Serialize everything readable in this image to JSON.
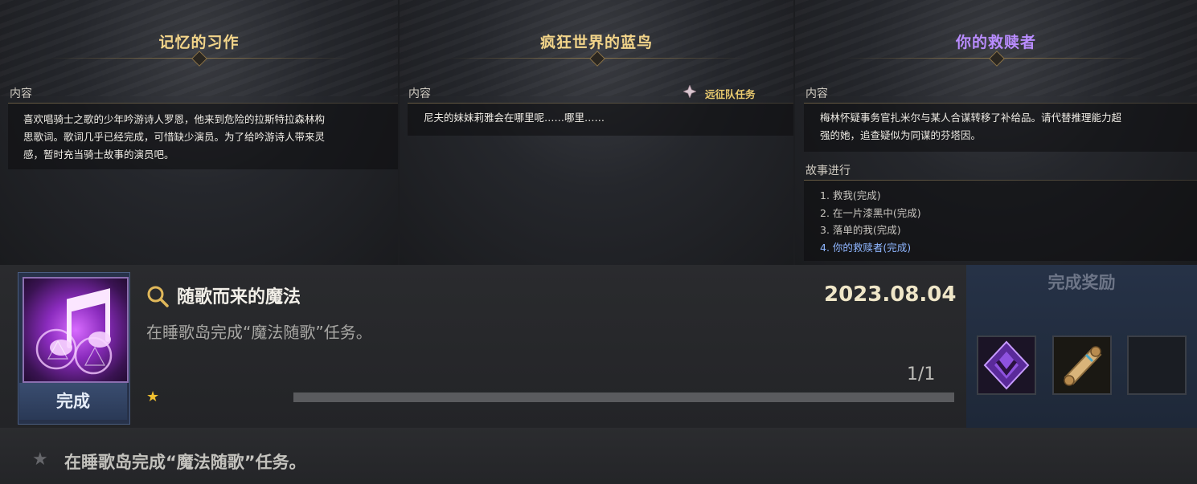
{
  "cards": [
    {
      "title": "记忆的习作",
      "title_color": "#f3d58a",
      "content_label": "内容",
      "description_lines": [
        "喜欢唱骑士之歌的少年吟游诗人罗恩，他来到危险的拉斯特拉森林构",
        "思歌词。歌词几乎已经完成，可惜缺少演员。为了给吟游诗人带来灵",
        "感，暂时充当骑士故事的演员吧。"
      ]
    },
    {
      "title": "疯狂世界的蓝鸟",
      "title_color": "#f3d58a",
      "content_label": "内容",
      "tag_label": "远征队任务",
      "description_lines": [
        "尼夫的妹妹莉雅会在哪里呢……哪里……"
      ]
    },
    {
      "title": "你的救赎者",
      "title_color": "#b98cff",
      "content_label": "内容",
      "description_lines": [
        "梅林怀疑事务官扎米尔与某人合谋转移了补给品。请代替推理能力超",
        "强的她，追查疑似为同谋的芬塔因。"
      ],
      "progress_label": "故事进行",
      "progress_items": [
        "1. 救我(完成)",
        "2. 在一片漆黑中(完成)",
        "3. 落单的我(完成)",
        "4. 你的救赎者(完成)"
      ]
    }
  ],
  "quest": {
    "title": "随歌而来的魔法",
    "date": "2023.08.04",
    "subtitle": "在睡歌岛完成“魔法随歌”任务。",
    "status": "完成",
    "count": "1/1",
    "progress": 1.0,
    "reward_title": "完成奖励",
    "icon": "music-note-icon",
    "rewards": [
      "purple-crystal-icon",
      "scroll-icon",
      "empty-slot"
    ]
  },
  "footer": {
    "text": "在睡歌岛完成“魔法随歌”任务。"
  },
  "colors": {
    "gold": "#f3d58a",
    "purple": "#b98cff",
    "active_step": "#8fb6ff"
  }
}
